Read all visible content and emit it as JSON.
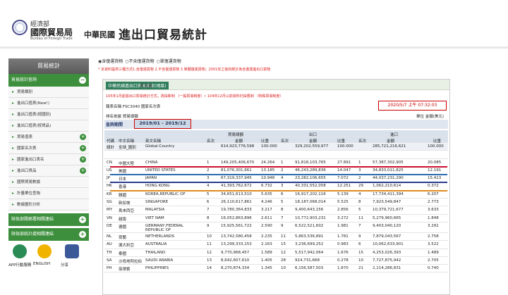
{
  "header": {
    "logo_cn": "經濟部",
    "logo_main": "國際貿易局",
    "logo_en": "Bureau of Foreign Trade",
    "roc": "中華民國",
    "title": "進出口貿易統計"
  },
  "sidebar": {
    "title": "貿易統計",
    "sections": [
      {
        "label": "貿易統計查詢"
      }
    ],
    "items": [
      "貿易類別",
      "進出口值表(New!)",
      "進出口值表(按國別)",
      "進出口值表(按貨品)",
      "貿易值表",
      "國家名次表",
      "國家進出口表名",
      "進出口貨品",
      "國際貿易數據",
      "計量單位查詢",
      "數據圖形分析"
    ],
    "footer_sections": [
      "財政部關務署相關連結",
      "財政部統計處相關連結"
    ]
  },
  "icons": [
    {
      "label": "APP行動服務",
      "name": "app-icon",
      "color": "#2a8c54"
    },
    {
      "label": "ENGLISH",
      "name": "english-icon",
      "color": "#f0b400"
    },
    {
      "label": "分享",
      "name": "facebook-share-icon",
      "color": "#3b5998"
    }
  ],
  "main": {
    "radios": [
      "◉含復運貨物",
      "○不含復運貨物",
      "○單復運貨物"
    ],
    "note": "* 本資料提供三種方式1.含復運貨物 2.不含復運貨物 3.單獨復運貨物；2001年之後的統計為含復運進出口貨物"
  },
  "panel": {
    "badge": "中華民國進出口貿易國家(地區)",
    "name": "名次表",
    "note": "105年1月起進出口貿易統計方式，改採新制 （一般貿易制度）• 104年12月以前資料仍採舊制 （特殊貿易制度）",
    "form": "報表名稱  FSC3040 國家名次表",
    "date": "2020/5/7 上午 07:32:03",
    "sort": "排名依據  貿易總額",
    "unit": "單位  金額(美元)",
    "period_label": "查詢期間",
    "period": "2019/01 - 2019/12"
  },
  "table": {
    "headers": [
      "代碼",
      "中文名稱",
      "英文名稱",
      "名次",
      "金額",
      "比重",
      "名次",
      "金額",
      "比重",
      "名次",
      "金額",
      "比重"
    ],
    "groups": [
      "貿易總額",
      "出口",
      "進口"
    ],
    "total": {
      "code": "總計",
      "cn": "全球_國別",
      "en": "Global-Country",
      "amount1": "614,923,776,598",
      "share1": "100.000",
      "amount2": "329,202,559,977",
      "share2": "100.000",
      "amount3": "285,721,216,621",
      "share3": "100.000"
    },
    "rows": [
      {
        "code": "CN",
        "cn": "中國大陸",
        "en": "CHINA",
        "r1": "1",
        "a1": "149,205,406,670",
        "s1": "24.264",
        "r2": "1",
        "a2": "91,818,103,765",
        "s2": "27.891",
        "r3": "1",
        "a3": "57,387,302,905",
        "s3": "20.085"
      },
      {
        "code": "US",
        "cn": "美國",
        "en": "UNITED STATES",
        "r1": "2",
        "a1": "81,076,301,661",
        "s1": "13.185",
        "r2": "2",
        "a2": "46,243,289,836",
        "s2": "14.047",
        "r3": "3",
        "a3": "34,833,011,825",
        "s3": "12.191"
      },
      {
        "code": "JP",
        "cn": "日本",
        "en": "JAPAN",
        "r1": "3",
        "a1": "67,319,337,945",
        "s1": "10.948",
        "r2": "4",
        "a2": "23,282,106,655",
        "s2": "7.072",
        "r3": "2",
        "a3": "44,037,231,290",
        "s3": "15.413"
      },
      {
        "code": "HK",
        "cn": "香港",
        "en": "HONG KONG",
        "r1": "4",
        "a1": "41,393,762,672",
        "s1": "6.732",
        "r2": "3",
        "a2": "40,331,552,058",
        "s2": "12.251",
        "r3": "29",
        "a3": "1,062,210,614",
        "s3": "0.372"
      },
      {
        "code": "KR",
        "cn": "韓國",
        "en": "KOREA,REPUBLIC OF",
        "r1": "5",
        "a1": "34,651,613,510",
        "s1": "5.635",
        "r2": "6",
        "a2": "16,917,202,116",
        "s2": "5.139",
        "r3": "4",
        "a3": "17,734,411,394",
        "s3": "6.207"
      },
      {
        "code": "SG",
        "cn": "新加坡",
        "en": "SINGAPORE",
        "r1": "6",
        "a1": "26,110,617,861",
        "s1": "4.246",
        "r2": "5",
        "a2": "18,187,068,014",
        "s2": "5.525",
        "r3": "8",
        "a3": "7,923,549,847",
        "s3": "2.773"
      },
      {
        "code": "MY",
        "cn": "馬來西亞",
        "en": "MALAYSIA",
        "r1": "7",
        "a1": "19,780,364,833",
        "s1": "3.217",
        "r2": "8",
        "a2": "9,400,643,156",
        "s2": "2.856",
        "r3": "5",
        "a3": "10,379,721,677",
        "s3": "3.633"
      },
      {
        "code": "VN",
        "cn": "越南",
        "en": "VIET NAM",
        "r1": "8",
        "a1": "16,052,863,896",
        "s1": "2.611",
        "r2": "7",
        "a2": "10,772,903,231",
        "s2": "3.272",
        "r3": "11",
        "a3": "5,279,960,665",
        "s3": "1.848"
      },
      {
        "code": "DE",
        "cn": "德國",
        "en": "GERMANY,FEDERAL REPUBLIC OF",
        "r1": "9",
        "a1": "15,925,561,722",
        "s1": "2.590",
        "r2": "9",
        "a2": "6,522,521,602",
        "s2": "1.981",
        "r3": "7",
        "a3": "9,403,040,120",
        "s3": "3.291"
      },
      {
        "code": "NL",
        "cn": "荷蘭",
        "en": "NETHERLANDS",
        "r1": "10",
        "a1": "13,742,580,458",
        "s1": "2.235",
        "r2": "11",
        "a2": "5,863,536,891",
        "s2": "1.781",
        "r3": "9",
        "a3": "7,879,043,567",
        "s3": "2.758"
      },
      {
        "code": "AU",
        "cn": "澳大利亞",
        "en": "AUSTRALIA",
        "r1": "11",
        "a1": "13,299,333,153",
        "s1": "2.163",
        "r2": "15",
        "a2": "3,236,699,252",
        "s2": "0.983",
        "r3": "6",
        "a3": "10,062,633,901",
        "s3": "3.522"
      },
      {
        "code": "TH",
        "cn": "泰國",
        "en": "THAILAND",
        "r1": "12",
        "a1": "9,770,968,457",
        "s1": "1.589",
        "r2": "12",
        "a2": "5,517,942,064",
        "s2": "1.676",
        "r3": "15",
        "a3": "4,253,026,393",
        "s3": "1.489"
      },
      {
        "code": "SA",
        "cn": "沙烏地阿拉伯",
        "en": "SAUDI ARABIA",
        "r1": "13",
        "a1": "8,642,607,610",
        "s1": "1.405",
        "r2": "28",
        "a2": "914,731,668",
        "s2": "0.278",
        "r3": "10",
        "a3": "7,727,875,942",
        "s3": "2.705"
      },
      {
        "code": "PH",
        "cn": "菲律賓",
        "en": "PHILIPPINES",
        "r1": "14",
        "a1": "8,270,874,334",
        "s1": "1.345",
        "r2": "10",
        "a2": "6,156,587,503",
        "s2": "1.870",
        "r3": "21",
        "a3": "2,114,286,831",
        "s3": "0.740"
      }
    ]
  },
  "underline_colors": [
    "#c8102e",
    "#2a6ab0",
    "#2b3a8f",
    "#e08a1e"
  ]
}
